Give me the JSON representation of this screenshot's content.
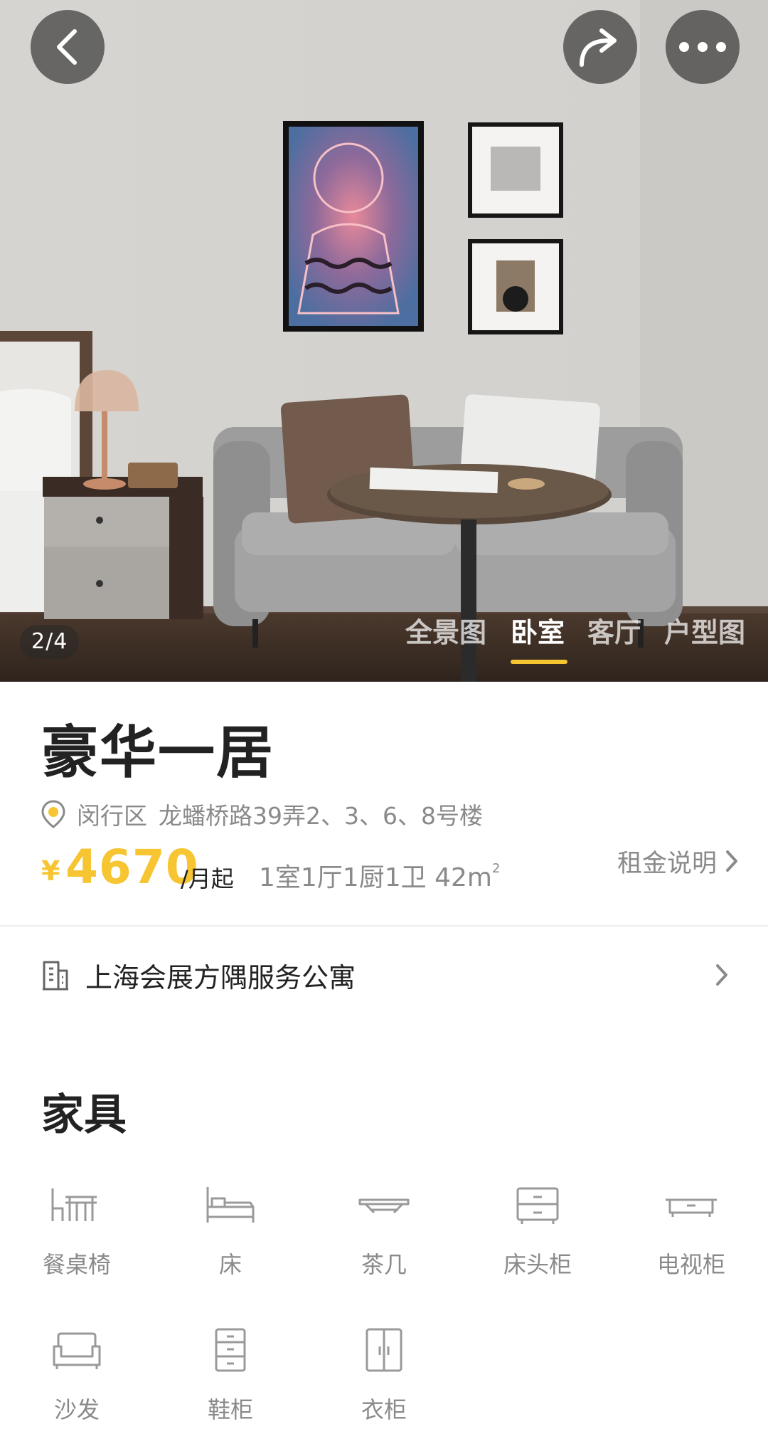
{
  "hero": {
    "counter": "2/4",
    "tabs": [
      {
        "label": "全景图",
        "active": false
      },
      {
        "label": "卧室",
        "active": true
      },
      {
        "label": "客厅",
        "active": false
      },
      {
        "label": "户型图",
        "active": false
      }
    ],
    "buttons": {
      "back": "back-icon",
      "share": "share-icon",
      "more": "more-icon"
    }
  },
  "listing": {
    "title": "豪华一居",
    "district": "闵行区",
    "street": "龙蟠桥路39弄2、3、6、8号楼",
    "currency": "¥",
    "price": "4670",
    "price_unit": "/月起",
    "layout": "1室1厅1厨1卫",
    "area": "42m",
    "area_sup": "2",
    "rent_note": "租金说明"
  },
  "apartment": {
    "name": "上海会展方隅服务公寓",
    "icon": "building-icon"
  },
  "furniture": {
    "title": "家具",
    "items": [
      {
        "label": "餐桌椅",
        "icon": "dining-set-icon"
      },
      {
        "label": "床",
        "icon": "bed-icon"
      },
      {
        "label": "茶几",
        "icon": "coffee-table-icon"
      },
      {
        "label": "床头柜",
        "icon": "nightstand-icon"
      },
      {
        "label": "电视柜",
        "icon": "tv-cabinet-icon"
      },
      {
        "label": "沙发",
        "icon": "sofa-icon"
      },
      {
        "label": "鞋柜",
        "icon": "shoe-cabinet-icon"
      },
      {
        "label": "衣柜",
        "icon": "wardrobe-icon"
      }
    ]
  },
  "colors": {
    "accent": "#f6c531",
    "text_primary": "#222222",
    "text_secondary": "#8a8a8a"
  }
}
